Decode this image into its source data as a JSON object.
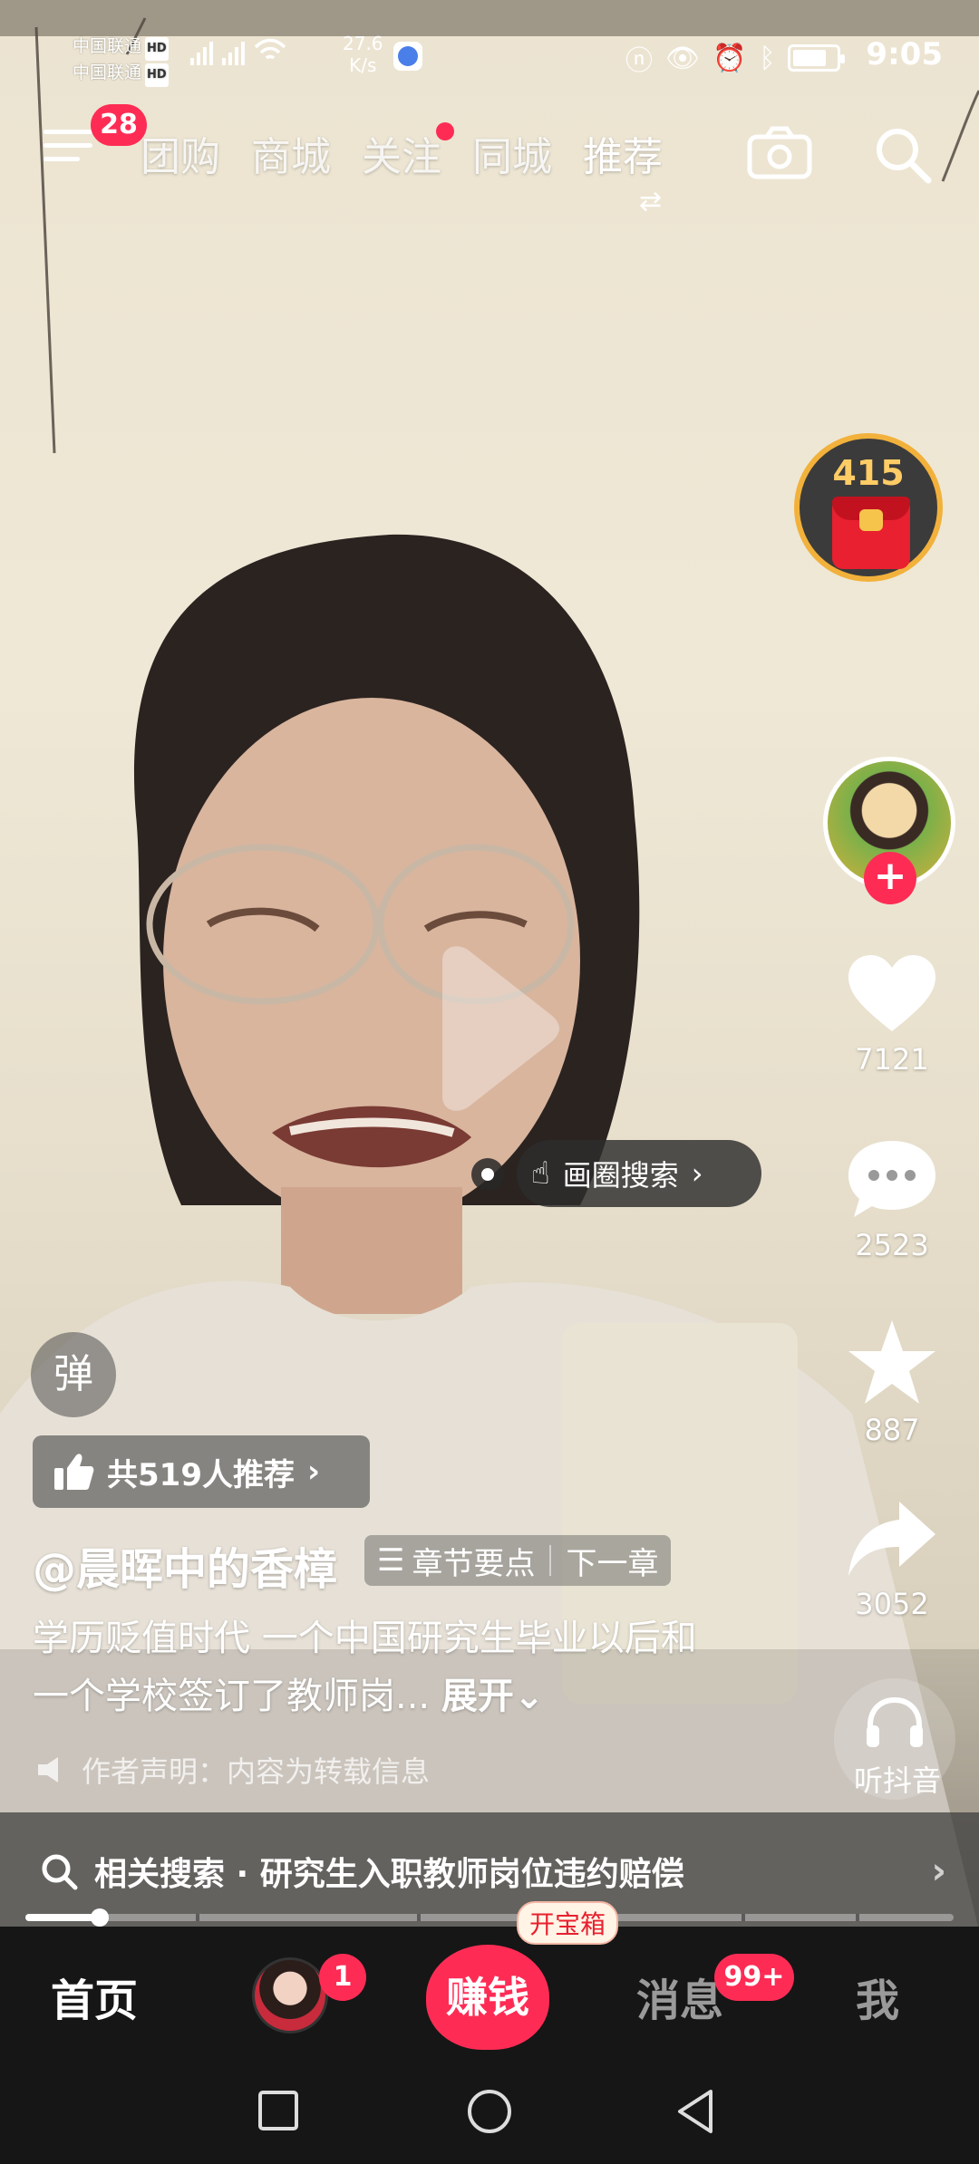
{
  "status_bar": {
    "carrier1": "中国联通",
    "carrier2": "中国联通",
    "hd": "HD",
    "speed_value": "27.6",
    "speed_unit": "K/s",
    "time": "9:05"
  },
  "top_nav": {
    "menu_badge": "28",
    "tabs": [
      {
        "label": "团购"
      },
      {
        "label": "商城"
      },
      {
        "label": "关注"
      },
      {
        "label": "同城"
      },
      {
        "label": "推荐"
      }
    ],
    "active_tab": "推荐"
  },
  "right_rail": {
    "coin_count": "415",
    "like_count": "7121",
    "comment_count": "2523",
    "favorite_count": "887",
    "share_count": "3052",
    "listen_label": "听抖音"
  },
  "circle_search": {
    "label": "画圈搜索"
  },
  "overlay": {
    "danmu": "弹",
    "recommend": "共519人推荐",
    "author": "@晨晖中的香樟",
    "chapter_points": "章节要点",
    "next_chapter": "下一章",
    "description": "学历贬值时代 一个中国研究生毕业以后和一个学校签订了教师岗...",
    "expand": "展开",
    "declaration": "作者声明：内容为转载信息",
    "related_search": "相关搜索 · 研究生入职教师岗位违约赔偿"
  },
  "progress": {
    "fraction": 0.08
  },
  "bottom_nav": {
    "home": "首页",
    "friend_badge": "1",
    "earn": "赚钱",
    "earn_tag": "开宝箱",
    "messages": "消息",
    "messages_badge": "99+",
    "me": "我"
  },
  "icons": [
    "menu-icon",
    "camera-icon",
    "search-icon",
    "heart-icon",
    "comment-icon",
    "star-icon",
    "share-icon",
    "headphones-icon",
    "thumbs-up-icon",
    "speaker-icon",
    "play-icon",
    "square-icon",
    "circle-icon",
    "back-icon"
  ]
}
